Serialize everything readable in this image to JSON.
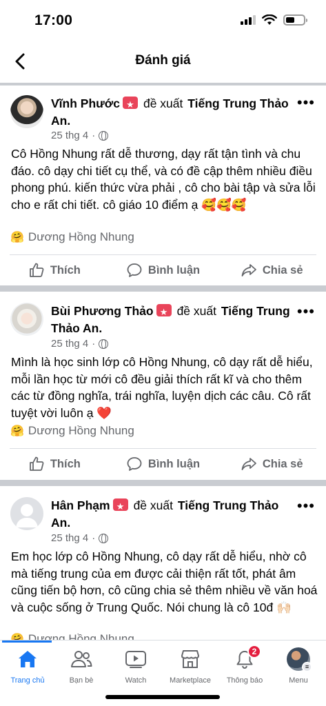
{
  "status": {
    "time": "17:00"
  },
  "header": {
    "title": "Đánh giá"
  },
  "posts": [
    {
      "author": "Vĩnh Phước",
      "verb": "đề xuất",
      "page": "Tiếng Trung Thảo An.",
      "date": "25 thg 4",
      "body": "Cô Hồng Nhung rất dễ thương, dạy rất tận tình và chu đáo. cô dạy chi tiết cụ thể, và có đề cập thêm nhiều điều phong phú. kiến thức vừa phải , cô cho bài tập và sửa lỗi cho e rất chi tiết. cô giáo 10 điểm ạ 🥰🥰🥰",
      "tagged": "Dương Hồng Nhung"
    },
    {
      "author": "Bùi Phương Thảo",
      "verb": "đề xuất",
      "page": "Tiếng Trung Thảo An.",
      "date": "25 thg 4",
      "body": "Mình là học sinh lớp cô Hồng Nhung, cô dạy rất dễ hiểu, mỗi lần học từ mới cô đều giải thích rất kĩ và cho thêm các từ đồng nghĩa, trái nghĩa, luyện dịch các câu. Cô rất tuyệt vời luôn ạ ❤️",
      "tagged": "Dương Hồng Nhung"
    },
    {
      "author": "Hân Phạm",
      "verb": "đề xuất",
      "page": "Tiếng Trung Thảo An.",
      "date": "25 thg 4",
      "body": "Em học lớp cô Hồng Nhung, cô dạy rất dễ hiểu, nhờ cô mà tiếng trung của em được cải thiện rất tốt, phát âm cũng tiến bộ hơn, cô cũng chia sẻ thêm nhiều về văn hoá và cuộc sống ở Trung Quốc. Nói chung là cô 10đ 🙌🏻",
      "tagged": "Dương Hồng Nhung"
    }
  ],
  "actions": {
    "like": "Thích",
    "comment": "Bình luận",
    "share": "Chia sẻ"
  },
  "tabs": {
    "home": "Trang chủ",
    "friends": "Bạn bè",
    "watch": "Watch",
    "marketplace": "Marketplace",
    "notifications": "Thông báo",
    "notifications_count": "2",
    "menu": "Menu"
  },
  "colors": {
    "accent": "#1877f2",
    "badge": "#e41e3f",
    "recommend_badge": "#e9445a",
    "muted": "#65676b"
  }
}
